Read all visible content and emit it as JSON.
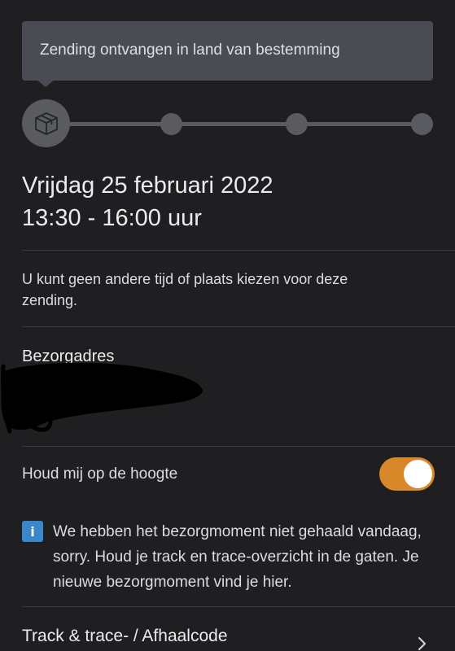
{
  "status_tooltip": {
    "text": "Zending ontvangen in land van bestemming"
  },
  "progress": {
    "steps": 4,
    "current_step": 1,
    "current_icon": "package-icon"
  },
  "delivery": {
    "date": "Vrijdag 25 februari 2022",
    "time": "13:30 - 16:00 uur"
  },
  "notice": {
    "text": "U kunt geen andere tijd of plaats kiezen voor deze zending."
  },
  "address": {
    "label": "Bezorgadres"
  },
  "updates": {
    "label": "Houd mij op de hoogte",
    "enabled": true,
    "accent_color": "#d88729"
  },
  "info": {
    "icon": "info-icon",
    "glyph": "i",
    "text": "We hebben het bezorgmoment niet gehaald vandaag, sorry. Houd je track en trace-overzicht in de gaten. Je nieuwe bezorgmoment vind je hier.",
    "icon_color": "#3b86c9"
  },
  "track": {
    "label": "Track & trace- / Afhaalcode",
    "icon": "chevron-right-icon"
  }
}
